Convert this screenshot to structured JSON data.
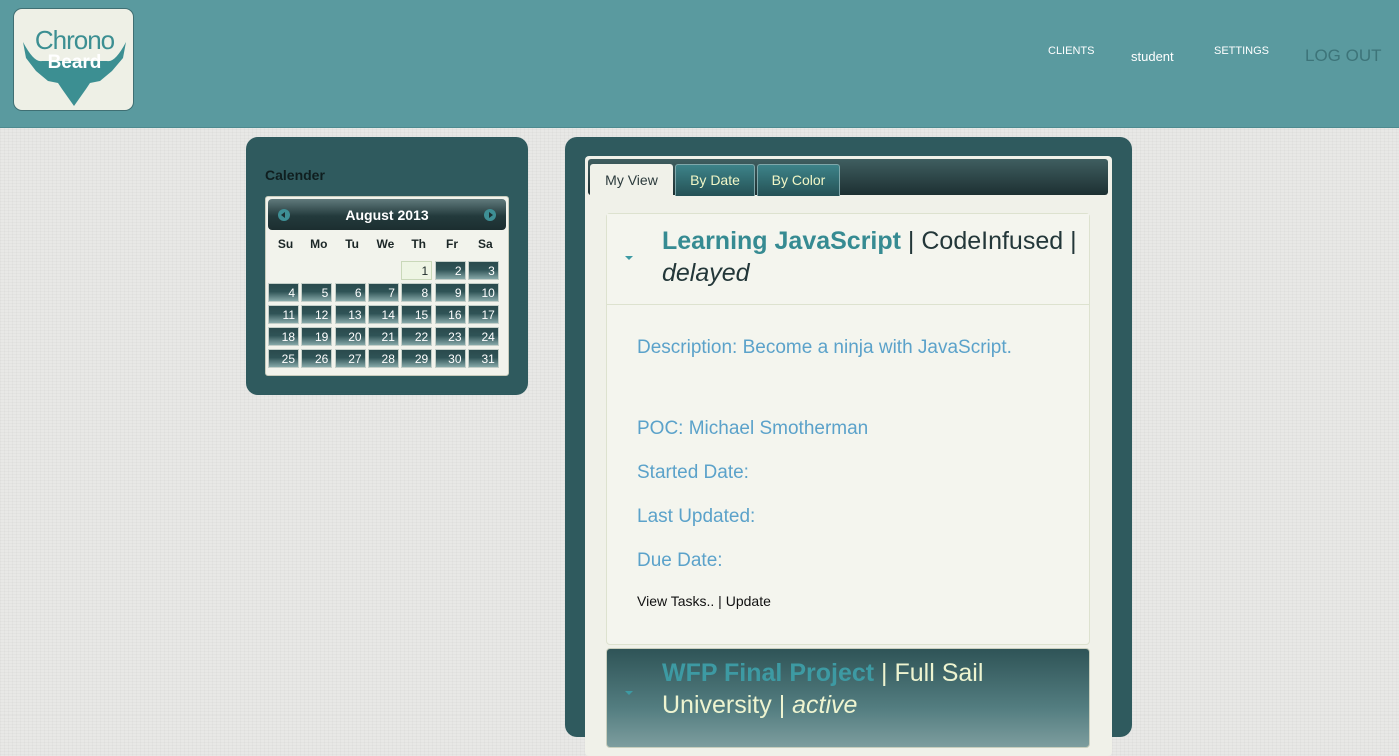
{
  "logo": {
    "line1": "Chrono",
    "line2": "Beard"
  },
  "nav": {
    "clients": "CLIENTS",
    "user": "student",
    "settings": "SETTINGS",
    "logout": "LOG OUT"
  },
  "calendar": {
    "title": "Calender",
    "month": "August 2013",
    "days_of_week": [
      "Su",
      "Mo",
      "Tu",
      "We",
      "Th",
      "Fr",
      "Sa"
    ],
    "first_weekday": 4,
    "days_in_month": 31,
    "today": 1
  },
  "tabs": [
    {
      "label": "My View",
      "active": true
    },
    {
      "label": "By Date",
      "active": false
    },
    {
      "label": "By Color",
      "active": false
    }
  ],
  "projects": [
    {
      "name": "Learning JavaScript",
      "client": "CodeInfused",
      "status": "delayed",
      "description": "Description: Become a ninja with JavaScript.",
      "poc": "POC: Michael Smotherman",
      "started": "Started Date:",
      "updated": "Last Updated:",
      "due": "Due Date:",
      "view_tasks": "View Tasks..",
      "update": "Update"
    },
    {
      "name": "WFP Final Project",
      "client": "Full Sail University",
      "status": "active"
    }
  ],
  "colors": {
    "header": "#5a9a9f",
    "panel": "#2f5a5e",
    "accent": "#368b92",
    "field_text": "#5ba2ca"
  }
}
